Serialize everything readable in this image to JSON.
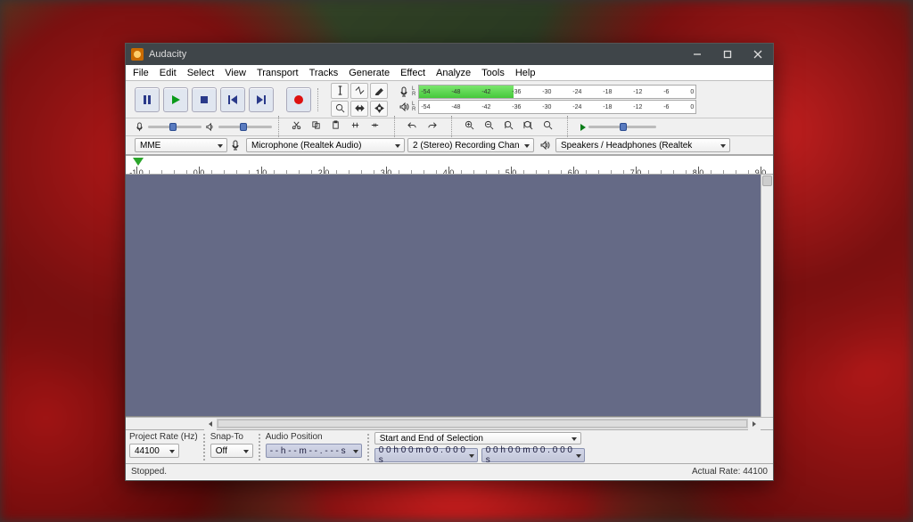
{
  "titlebar": {
    "title": "Audacity"
  },
  "menu": [
    "File",
    "Edit",
    "Select",
    "View",
    "Transport",
    "Tracks",
    "Generate",
    "Effect",
    "Analyze",
    "Tools",
    "Help"
  ],
  "transport": {
    "buttons": [
      "pause",
      "play",
      "stop",
      "skip-start",
      "skip-end",
      "record"
    ]
  },
  "meters": {
    "ticks": [
      "-54",
      "-48",
      "-42",
      "-36",
      "-30",
      "-24",
      "-18",
      "-12",
      "-6",
      "0"
    ]
  },
  "devices": {
    "host": "MME",
    "input": "Microphone (Realtek Audio)",
    "channels": "2 (Stereo) Recording Chan",
    "output": "Speakers / Headphones (Realtek"
  },
  "timeline": {
    "labels": [
      "-1.0",
      "0.0",
      "1.0",
      "2.0",
      "3.0",
      "4.0",
      "5.0",
      "6.0",
      "7.0",
      "8.0",
      "9.0"
    ]
  },
  "bottom": {
    "rate_label": "Project Rate (Hz)",
    "rate_value": "44100",
    "snap_label": "Snap-To",
    "snap_value": "Off",
    "audiopos_label": "Audio Position",
    "audiopos_value": "- - h - - m - - . - - - s",
    "selection_label": "Start and End of Selection",
    "selection_start": "0 0 h 0 0 m 0 0 . 0 0 0 s",
    "selection_end": "0 0 h 0 0 m 0 0 . 0 0 0 s"
  },
  "status": {
    "left": "Stopped.",
    "right": "Actual Rate: 44100"
  }
}
